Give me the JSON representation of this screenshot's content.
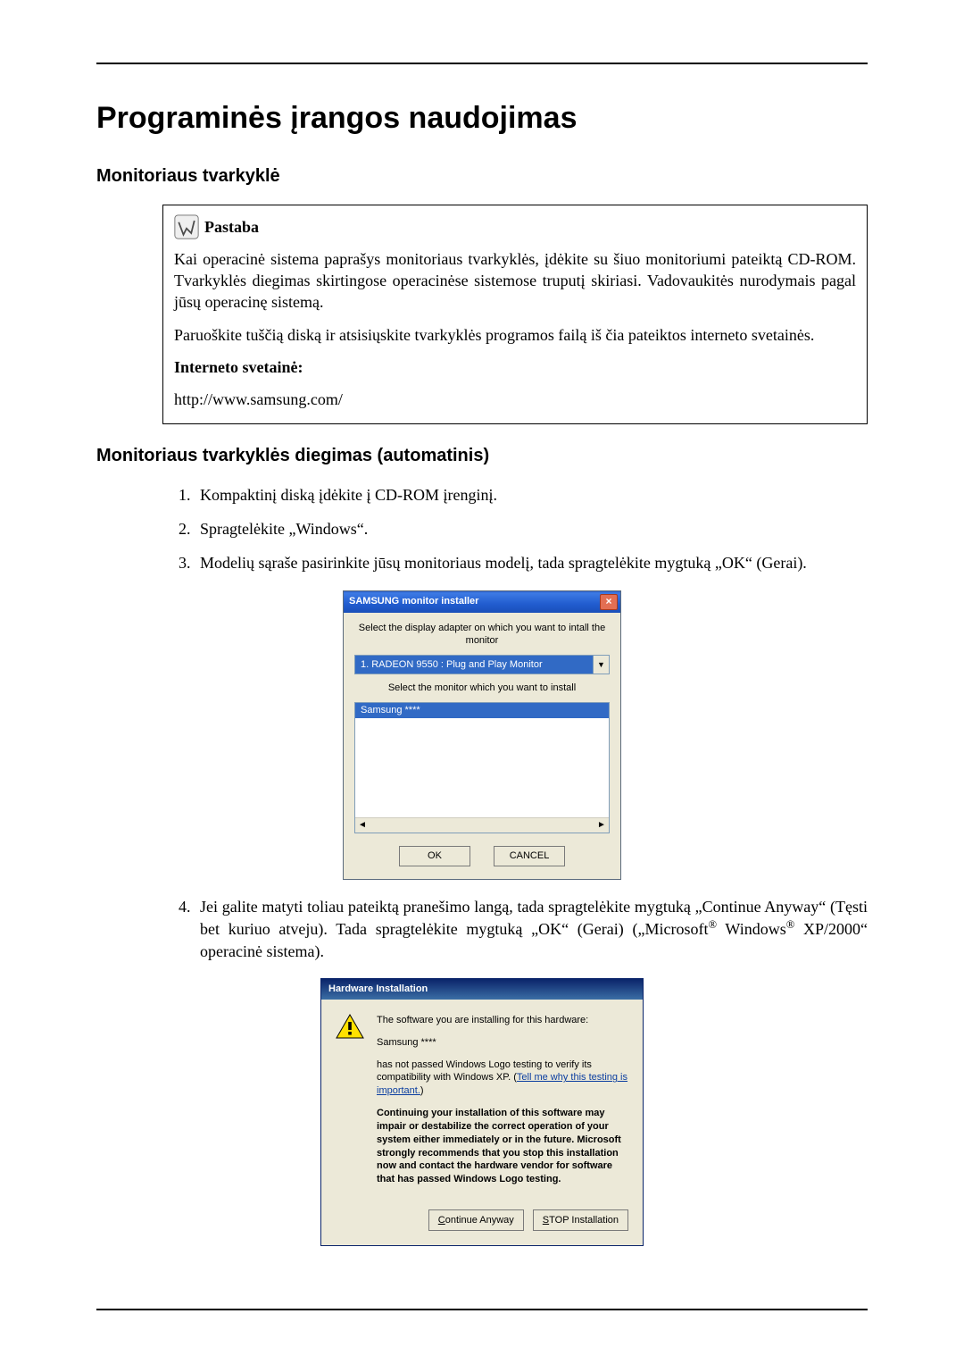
{
  "page": {
    "title": "Programinės įrangos naudojimas",
    "section1": "Monitoriaus tvarkyklė",
    "section2": "Monitoriaus tvarkyklės diegimas (automatinis)"
  },
  "note": {
    "label": "Pastaba",
    "p1": "Kai operacinė sistema paprašys monitoriaus tvarkyklės, įdėkite su šiuo monitoriumi pateiktą CD-ROM. Tvarkyklės diegimas skirtingose operacinėse sistemose truputį skiriasi. Vadovaukitės nurodymais pagal jūsų operacinę sistemą.",
    "p2": "Paruoškite tuščią diską ir atsisiųskite tvarkyklės programos failą iš čia pateiktos interneto svetainės.",
    "website_label": "Interneto svetainė:",
    "website_url": "http://www.samsung.com/"
  },
  "steps": {
    "s1": "Kompaktinį diską įdėkite į CD-ROM įrenginį.",
    "s2": "Spragtelėkite „Windows“.",
    "s3": "Modelių sąraše pasirinkite jūsų monitoriaus modelį, tada spragtelėkite mygtuką „OK“ (Gerai).",
    "s4_a": "Jei galite matyti toliau pateiktą pranešimo langą, tada spragtelėkite mygtuką „Continue Anyway“ (Tęsti bet kuriuo atveju). Tada spragtelėkite mygtuką „OK“ (Gerai) („Microsoft",
    "s4_b": " Windows",
    "s4_c": " XP/2000“ operacinė sistema)."
  },
  "installer": {
    "title": "SAMSUNG monitor installer",
    "label_adapter": "Select the display adapter on which you want to intall the monitor",
    "adapter_value": "1. RADEON 9550 : Plug and Play Monitor",
    "label_monitor": "Select the monitor which you want to install",
    "selected_monitor": "Samsung ****",
    "btn_ok": "OK",
    "btn_cancel": "CANCEL"
  },
  "hw": {
    "title": "Hardware Installation",
    "line1": "The software you are installing for this hardware:",
    "line2": "Samsung ****",
    "line3a": "has not passed Windows Logo testing to verify its compatibility with Windows XP. (",
    "link": "Tell me why this testing is important.",
    "line3b": ")",
    "bold": "Continuing your installation of this software may impair or destabilize the correct operation of your system either immediately or in the future. Microsoft strongly recommends that you stop this installation now and contact the hardware vendor for software that has passed Windows Logo testing.",
    "btn_continue_u": "C",
    "btn_continue_rest": "ontinue Anyway",
    "btn_stop_u": "S",
    "btn_stop_rest": "TOP Installation"
  }
}
